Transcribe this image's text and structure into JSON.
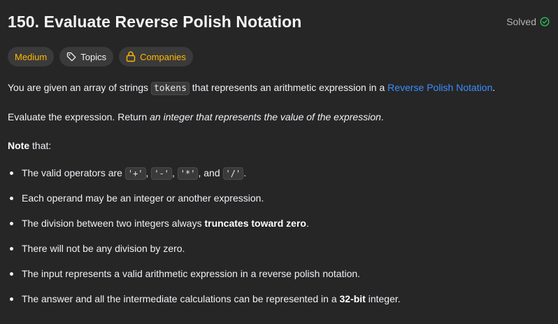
{
  "header": {
    "title": "150. Evaluate Reverse Polish Notation",
    "status": "Solved"
  },
  "tags": {
    "difficulty": "Medium",
    "topics": "Topics",
    "companies": "Companies"
  },
  "description": {
    "p1_before": "You are given an array of strings ",
    "p1_code": "tokens",
    "p1_middle": " that represents an arithmetic expression in a ",
    "p1_link": "Reverse Polish Notation",
    "p1_after": ".",
    "p2_before": "Evaluate the expression. Return ",
    "p2_italic": "an integer that represents the value of the expression",
    "p2_after": ".",
    "note_bold": "Note",
    "note_rest": " that:"
  },
  "bullets": {
    "b1_before": "The valid operators are ",
    "op1": "'+'",
    "sep1": ", ",
    "op2": "'-'",
    "sep2": ", ",
    "op3": "'*'",
    "sep3": ", and ",
    "op4": "'/'",
    "b1_after": ".",
    "b2": "Each operand may be an integer or another expression.",
    "b3_before": "The division between two integers always ",
    "b3_bold": "truncates toward zero",
    "b3_after": ".",
    "b4": "There will not be any division by zero.",
    "b5": "The input represents a valid arithmetic expression in a reverse polish notation.",
    "b6_before": "The answer and all the intermediate calculations can be represented in a ",
    "b6_bold": "32-bit",
    "b6_after": " integer."
  },
  "colors": {
    "background": "#262626",
    "difficulty_medium": "#ffb800",
    "link": "#3c8dff",
    "solved_check": "#2cbb5d"
  }
}
